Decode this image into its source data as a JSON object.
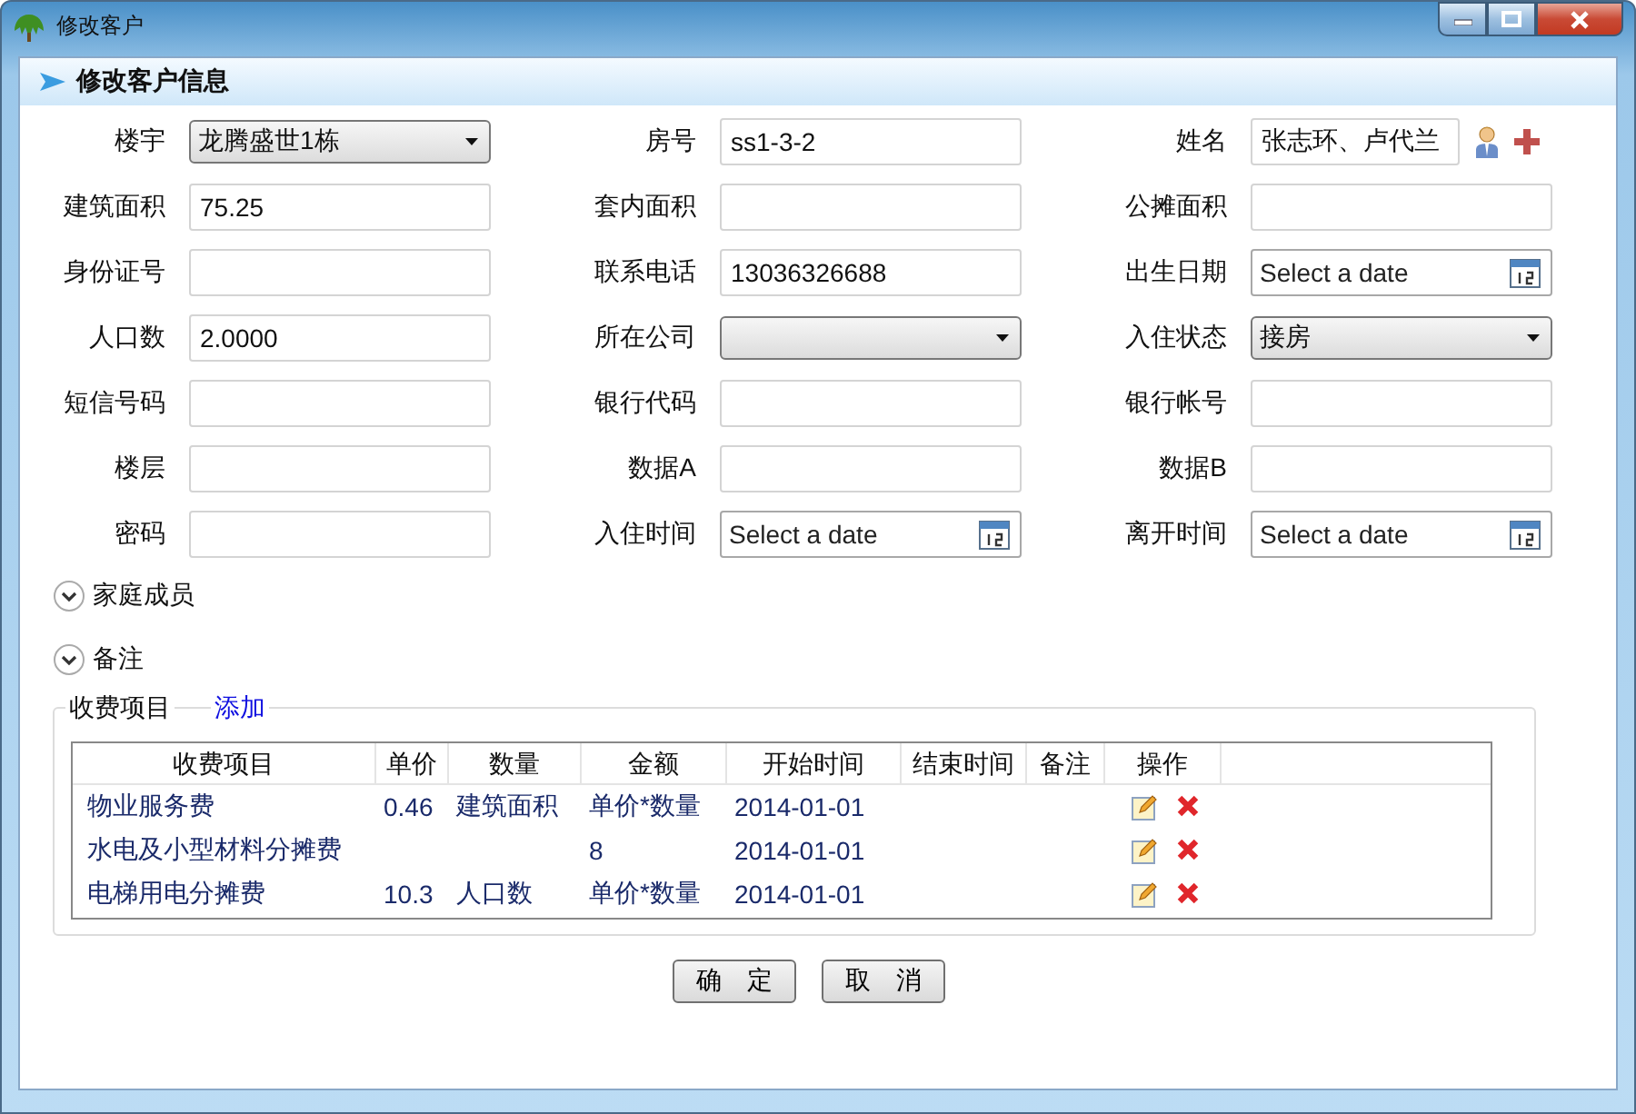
{
  "window": {
    "title": "修改客户"
  },
  "header": {
    "title": "修改客户信息"
  },
  "fields": [
    {
      "label": "楼宇",
      "kind": "select",
      "value": "龙腾盛世1栋"
    },
    {
      "label": "房号",
      "kind": "text",
      "value": "ss1-3-2"
    },
    {
      "label": "姓名",
      "kind": "person",
      "value": "张志环、卢代兰"
    },
    {
      "label": "建筑面积",
      "kind": "text",
      "value": "75.25"
    },
    {
      "label": "套内面积",
      "kind": "text"
    },
    {
      "label": "公摊面积",
      "kind": "text"
    },
    {
      "label": "身份证号",
      "kind": "text"
    },
    {
      "label": "联系电话",
      "kind": "text",
      "value": "13036326688"
    },
    {
      "label": "出生日期",
      "kind": "date",
      "placeholder": "Select a date"
    },
    {
      "label": "人口数",
      "kind": "text",
      "value": "2.0000"
    },
    {
      "label": "所在公司",
      "kind": "select"
    },
    {
      "label": "入住状态",
      "kind": "select",
      "value": "接房"
    },
    {
      "label": "短信号码",
      "kind": "text"
    },
    {
      "label": "银行代码",
      "kind": "text"
    },
    {
      "label": "银行帐号",
      "kind": "text"
    },
    {
      "label": "楼层",
      "kind": "text"
    },
    {
      "label": "数据A",
      "kind": "text"
    },
    {
      "label": "数据B",
      "kind": "text"
    },
    {
      "label": "密码",
      "kind": "text"
    },
    {
      "label": "入住时间",
      "kind": "date",
      "placeholder": "Select a date"
    },
    {
      "label": "离开时间",
      "kind": "date",
      "placeholder": "Select a date"
    }
  ],
  "sections": [
    {
      "label": "家庭成员",
      "expanded": false
    },
    {
      "label": "备注",
      "expanded": false
    }
  ],
  "fees": {
    "title": "收费项目",
    "add_link": "添加",
    "columns": [
      "收费项目",
      "单价",
      "数量",
      "金额",
      "开始时间",
      "结束时间",
      "备注",
      "操作"
    ],
    "rows": [
      {
        "item": "物业服务费",
        "price": "0.46",
        "quantity": "建筑面积",
        "amount": "单价*数量",
        "start": "2014-01-01"
      },
      {
        "item": "水电及小型材料分摊费",
        "amount": "8",
        "start": "2014-01-01"
      },
      {
        "item": "电梯用电分摊费",
        "price": "10.3",
        "quantity": "人口数",
        "amount": "单价*数量",
        "start": "2014-01-01"
      }
    ]
  },
  "buttons": [
    "确　定",
    "取　消"
  ]
}
